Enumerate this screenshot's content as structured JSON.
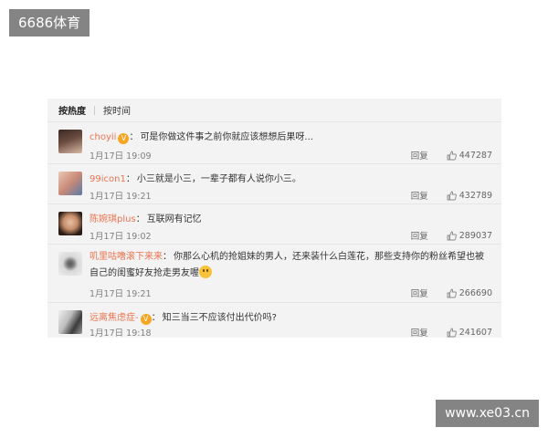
{
  "watermarks": {
    "top_left": "6686体育",
    "bottom_right": "www.xe03.cn"
  },
  "sort": {
    "hot": "按热度",
    "time": "按时间"
  },
  "reply_label": "回复",
  "comments": [
    {
      "user": "choyii",
      "text": "可是你做这件事之前你就应该想想后果呀...",
      "time": "1月17日 19:09",
      "likes": "447287"
    },
    {
      "user": "99icon1",
      "text": "小三就是小三，一辈子都有人说你小三。",
      "time": "1月17日 19:21",
      "likes": "432789"
    },
    {
      "user": "陈婉琪plus",
      "text": "互联网有记忆",
      "time": "1月17日 19:02",
      "likes": "289037"
    },
    {
      "user": "叽里咕噜滚下来来",
      "text": "你那么心机的抢姐妹的男人，还来装什么白莲花，那些支持你的粉丝希望也被自己的闺蜜好友抢走男友喔",
      "time": "1月17日 19:21",
      "likes": "266690"
    },
    {
      "user": "远离焦虑症-",
      "text": "知三当三不应该付出代价吗?",
      "time": "1月17日 19:18",
      "likes": "241607"
    }
  ],
  "colors": {
    "username": "#eb7350",
    "panel_bg": "#f3f3f3"
  },
  "icons": {
    "like": "thumb-up-icon",
    "vip": "vip-badge-icon"
  }
}
